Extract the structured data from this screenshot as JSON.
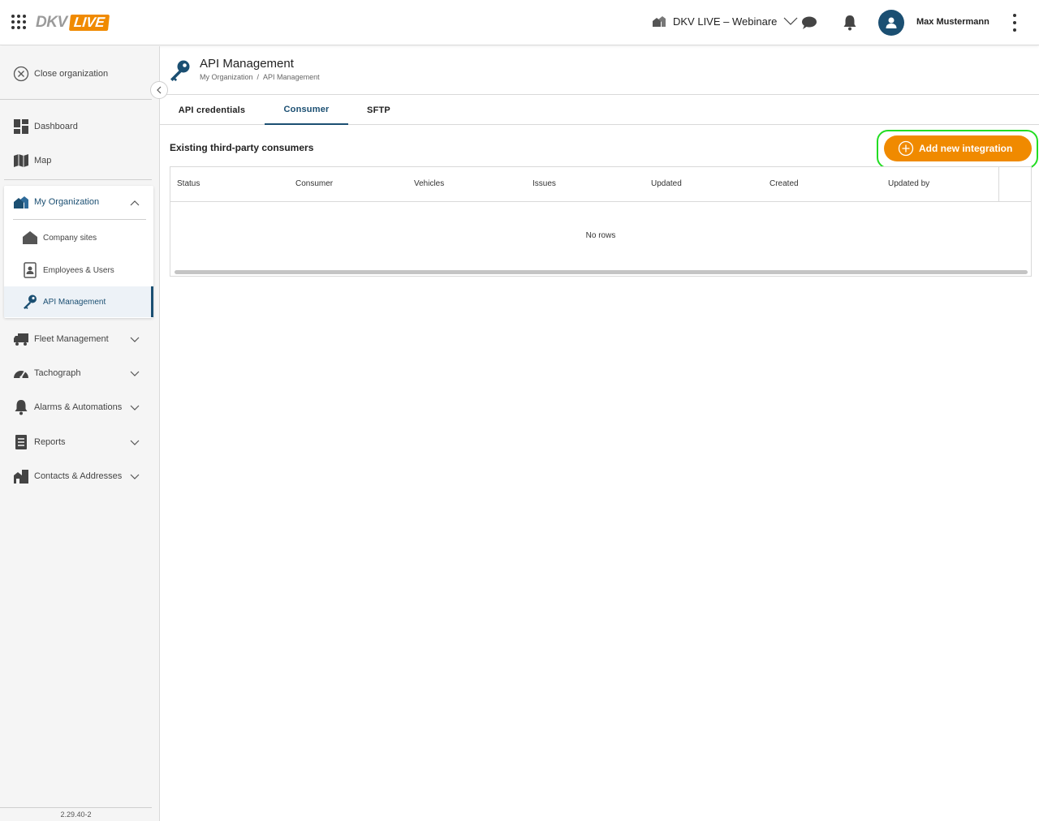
{
  "header": {
    "logo_dkv": "DKV",
    "logo_live": "LIVE",
    "org_name": "DKV LIVE – Webinare",
    "user_name": "Max Mustermann",
    "accent": "#f08a00",
    "brand": "#1b4f72"
  },
  "sidebar": {
    "close_org": "Close organization",
    "items_top": [
      {
        "label": "Dashboard",
        "icon": "dashboard-icon"
      },
      {
        "label": "Map",
        "icon": "map-icon"
      }
    ],
    "org_group": {
      "label": "My Organization",
      "icon": "organization-icon",
      "children": [
        {
          "label": "Company sites",
          "icon": "home-icon"
        },
        {
          "label": "Employees & Users",
          "icon": "badge-icon"
        },
        {
          "label": "API Management",
          "icon": "key-icon",
          "active": true
        }
      ]
    },
    "items_bottom": [
      {
        "label": "Fleet Management",
        "icon": "truck-icon"
      },
      {
        "label": "Tachograph",
        "icon": "gauge-icon"
      },
      {
        "label": "Alarms & Automations",
        "icon": "bell-icon"
      },
      {
        "label": "Reports",
        "icon": "report-icon"
      },
      {
        "label": "Contacts & Addresses",
        "icon": "contacts-icon"
      }
    ],
    "version": "2.29.40-2"
  },
  "main": {
    "title": "API Management",
    "breadcrumb": [
      "My Organization",
      "/",
      "API Management"
    ],
    "tabs": [
      {
        "label": "API credentials",
        "active": false
      },
      {
        "label": "Consumer",
        "active": true
      },
      {
        "label": "SFTP",
        "active": false
      }
    ],
    "section_title": "Existing third-party consumers",
    "add_button": "Add new integration",
    "table": {
      "columns": [
        "Status",
        "Consumer",
        "Vehicles",
        "Issues",
        "Updated",
        "Created",
        "Updated by"
      ],
      "empty_text": "No rows"
    }
  }
}
